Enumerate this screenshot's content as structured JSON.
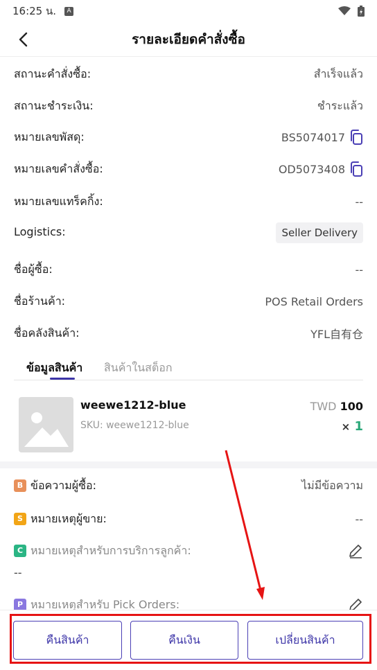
{
  "status_bar": {
    "time": "16:25 น.",
    "notif_letter": "A"
  },
  "header": {
    "title": "รายละเอียดคำสั่งซื้อ"
  },
  "details": [
    {
      "label": "สถานะคำสั่งซื้อ:",
      "value": "สำเร็จแล้ว"
    },
    {
      "label": "สถานะชำระเงิน:",
      "value": "ชำระแล้ว"
    },
    {
      "label": "หมายเลขพัสดุ:",
      "value": "BS5074017"
    },
    {
      "label": "หมายเลขคำสั่งซื้อ:",
      "value": "OD5073408"
    },
    {
      "label": "หมายเลขแทร็คกิ้ง:",
      "value": "--"
    },
    {
      "label": "Logistics:",
      "value": "Seller Delivery"
    },
    {
      "label": "ชื่อผู้ซื้อ:",
      "value": "--"
    },
    {
      "label": "ชื่อร้านค้า:",
      "value": "POS Retail Orders"
    },
    {
      "label": "ชื่อคลังสินค้า:",
      "value": "YFL自有仓"
    }
  ],
  "tabs": [
    {
      "label": "ข้อมูลสินค้า",
      "active": true
    },
    {
      "label": "สินค้าในสต็อก",
      "active": false
    }
  ],
  "product": {
    "name": "weewe1212-blue",
    "sku": "SKU: weewe1212-blue",
    "currency": "TWD",
    "price": "100",
    "qty_prefix": "×",
    "qty": "1"
  },
  "notes": [
    {
      "badge": "B",
      "badge_color": "#e8905a",
      "label": "ข้อความผู้ซื้อ:",
      "value": "ไม่มีข้อความ"
    },
    {
      "badge": "S",
      "badge_color": "#f2a516",
      "label": "หมายเหตุผู้ขาย:",
      "value": "--"
    },
    {
      "badge": "C",
      "badge_color": "#2bb584",
      "label": "หมายเหตุสำหรับการบริการลูกค้า:",
      "value": "--"
    },
    {
      "badge": "P",
      "badge_color": "#8a78e0",
      "label": "หมายเหตุสำหรับ Pick Orders:",
      "value": ""
    }
  ],
  "actions": {
    "return_goods": "คืนสินค้า",
    "refund": "คืนเงิน",
    "exchange": "เปลี่ยนสินค้า"
  },
  "colors": {
    "primary": "#3d35a8",
    "highlight": "#e61414",
    "success": "#2aa879"
  }
}
